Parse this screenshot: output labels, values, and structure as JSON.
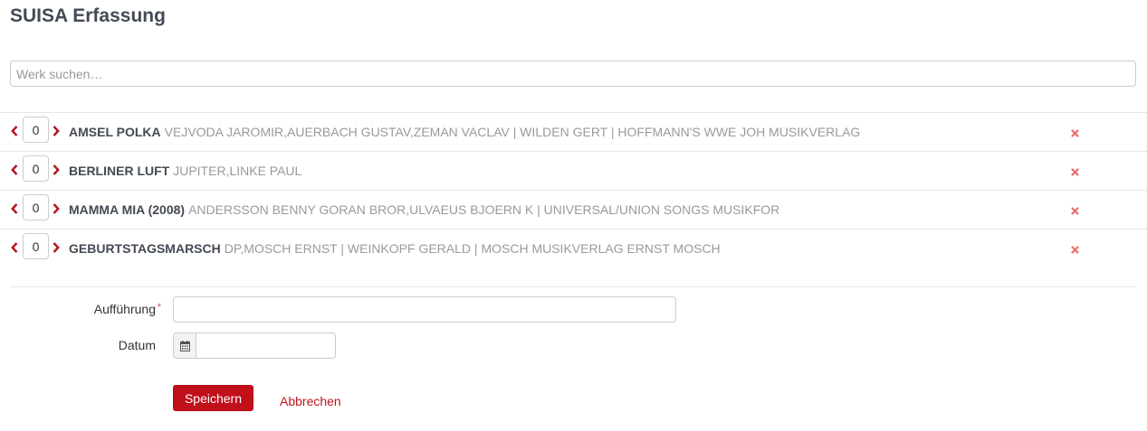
{
  "page": {
    "title": "SUISA Erfassung"
  },
  "search": {
    "placeholder": "Werk suchen…",
    "value": ""
  },
  "works": [
    {
      "count": "0",
      "title": "AMSEL POLKA",
      "details": "VEJVODA JAROMIR,AUERBACH GUSTAV,ZEMAN VACLAV | WILDEN GERT | HOFFMANN'S WWE JOH MUSIKVERLAG"
    },
    {
      "count": "0",
      "title": "BERLINER LUFT",
      "details": "JUPITER,LINKE PAUL"
    },
    {
      "count": "0",
      "title": "MAMMA MIA (2008)",
      "details": "ANDERSSON BENNY GORAN BROR,ULVAEUS BJOERN K | UNIVERSAL/UNION SONGS MUSIKFOR"
    },
    {
      "count": "0",
      "title": "GEBURTSTAGSMARSCH",
      "details": "DP,MOSCH ERNST | WEINKOPF GERALD | MOSCH MUSIKVERLAG ERNST MOSCH"
    }
  ],
  "form": {
    "performance": {
      "label": "Aufführung",
      "required_mark": "*",
      "value": ""
    },
    "date": {
      "label": "Datum",
      "value": ""
    },
    "save_label": "Speichern",
    "cancel_label": "Abbrechen"
  },
  "icons": {
    "decrement": "chevron-left-icon",
    "increment": "chevron-right-icon",
    "remove": "remove-icon",
    "calendar": "calendar-icon"
  },
  "colors": {
    "accent": "#c0101a",
    "remove": "#e96c6c",
    "title": "#434a54",
    "muted_text": "#9a9a9a",
    "divider": "#e6e6e6"
  }
}
